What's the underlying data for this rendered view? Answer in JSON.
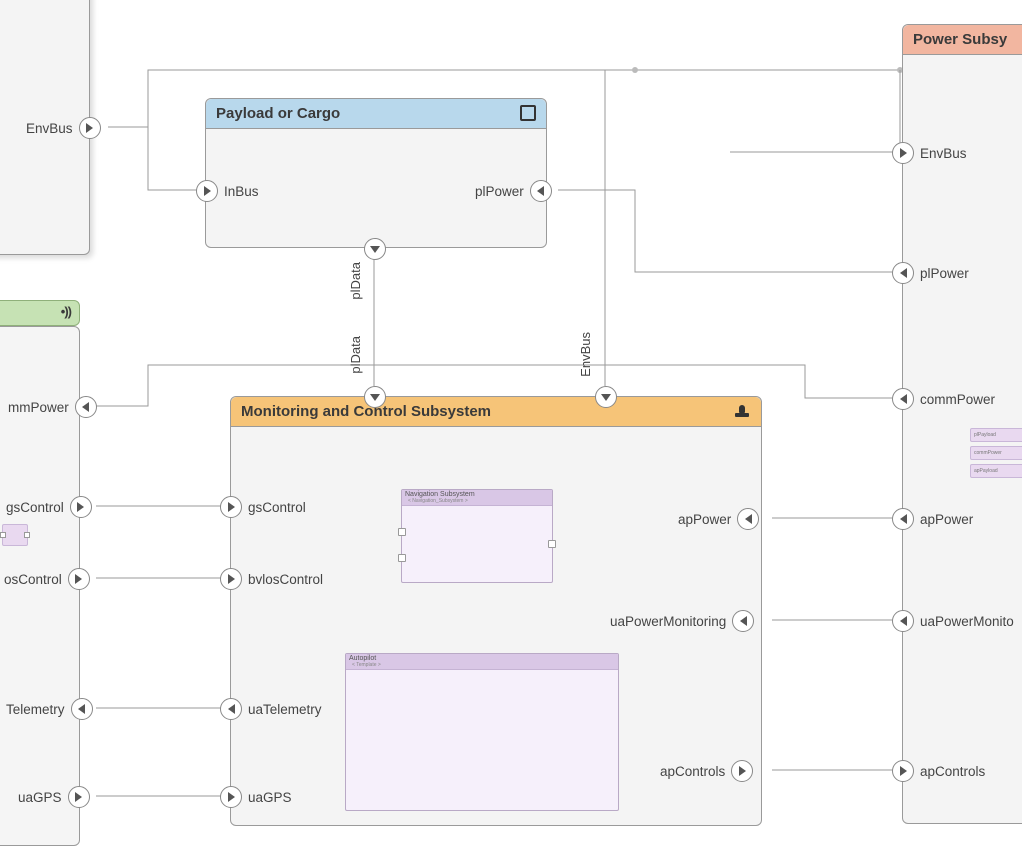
{
  "blocks": {
    "env_left": {
      "title": "",
      "port": "EnvBus"
    },
    "payload": {
      "title": "Payload or Cargo",
      "ports": {
        "inBus": "InBus",
        "plPower": "plPower",
        "plData": "plData"
      }
    },
    "power": {
      "title": "Power Subsy",
      "ports": {
        "envBus": "EnvBus",
        "plPower": "plPower",
        "commPower": "commPower",
        "apPower": "apPower",
        "uaPowerMonitoring": "uaPowerMonito",
        "apControls": "apControls"
      },
      "mini_rows": [
        "plPayload",
        "commPower",
        "apPayload"
      ]
    },
    "green_left": {},
    "comm_left": {
      "ports": {
        "mmPower": "mmPower",
        "gsControl": "gsControl",
        "osControl": "osControl",
        "telemetry": "Telemetry",
        "uaGPS": "uaGPS"
      }
    },
    "monitor": {
      "title": "Monitoring and Control Subsystem",
      "top_ports": {
        "plData": "plData",
        "envBus": "EnvBus"
      },
      "left_ports": {
        "gsControl": "gsControl",
        "bvlosControl": "bvlosControl",
        "uaTelemetry": "uaTelemetry",
        "uaGPS": "uaGPS"
      },
      "right_ports": {
        "apPower": "apPower",
        "uaPowerMonitoring": "uaPowerMonitoring",
        "apControls": "apControls"
      },
      "thumbs": {
        "nav": {
          "title": "Navigation Subsystem",
          "sub": "< Navigation_Subsystem >"
        },
        "auto": {
          "title": "Autopilot",
          "sub": "< Template >"
        }
      }
    }
  }
}
